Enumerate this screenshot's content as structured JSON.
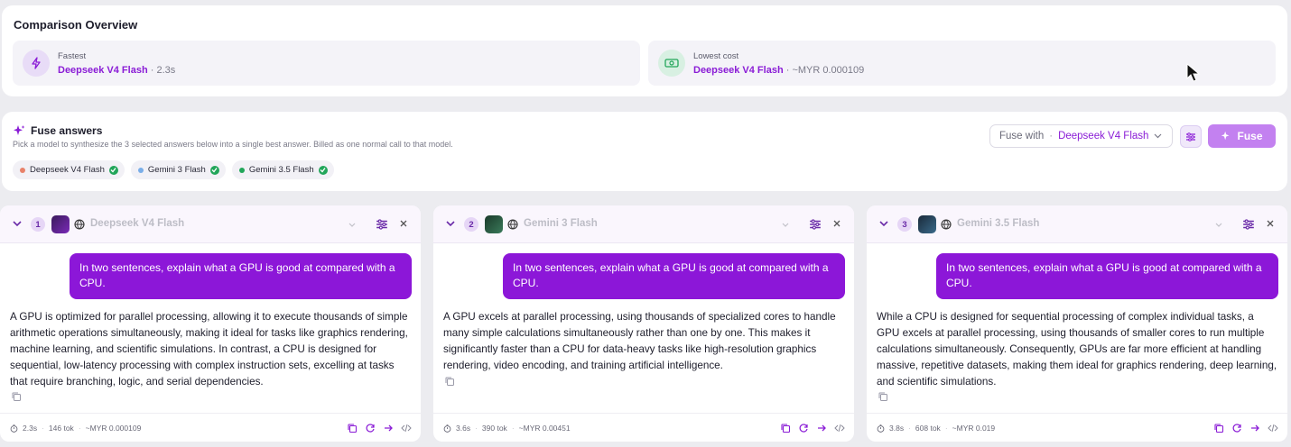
{
  "overview": {
    "title": "Comparison Overview",
    "fastest": {
      "label": "Fastest",
      "model": "Deepseek V4 Flash",
      "extra": " · 2.3s",
      "icon": "lightning-icon"
    },
    "lowest_cost": {
      "label": "Lowest cost",
      "model": "Deepseek V4 Flash",
      "extra": " · ~MYR 0.000109",
      "icon": "cash-icon"
    }
  },
  "fuse": {
    "title": "Fuse answers",
    "description": "Pick a model to synthesize the 3 selected answers below into a single best answer. Billed as one normal call to that model.",
    "chips": [
      {
        "label": "Deepseek V4 Flash",
        "color": "#e8826a"
      },
      {
        "label": "Gemini 3 Flash",
        "color": "#7aaee8"
      },
      {
        "label": "Gemini 3.5 Flash",
        "color": "#22a65a"
      }
    ],
    "fuse_with_label": "Fuse with",
    "fuse_with_value": "Deepseek V4 Flash",
    "button": "Fuse"
  },
  "panels": [
    {
      "index": "1",
      "name": "Deepseek V4 Flash",
      "prompt": "In two sentences, explain what a GPU is good at compared with a CPU.",
      "answer": "A GPU is optimized for parallel processing, allowing it to execute thousands of simple arithmetic operations simultaneously, making it ideal for tasks like graphics rendering, machine learning, and scientific simulations. In contrast, a CPU is designed for sequential, low-latency processing with complex instruction sets, excelling at tasks that require branching, logic, and serial dependencies.",
      "time": "2.3s",
      "tokens": "146 tok",
      "cost": "~MYR 0.000109"
    },
    {
      "index": "2",
      "name": "Gemini 3 Flash",
      "prompt": "In two sentences, explain what a GPU is good at compared with a CPU.",
      "answer": "A GPU excels at parallel processing, using thousands of specialized cores to handle many simple calculations simultaneously rather than one by one. This makes it significantly faster than a CPU for data-heavy tasks like high-resolution graphics rendering, video encoding, and training artificial intelligence.",
      "time": "3.6s",
      "tokens": "390 tok",
      "cost": "~MYR 0.00451"
    },
    {
      "index": "3",
      "name": "Gemini 3.5 Flash",
      "prompt": "In two sentences, explain what a GPU is good at compared with a CPU.",
      "answer": "While a CPU is designed for sequential processing of complex individual tasks, a GPU excels at parallel processing, using thousands of smaller cores to run multiple calculations simultaneously. Consequently, GPUs are far more efficient at handling massive, repetitive datasets, making them ideal for graphics rendering, deep learning, and scientific simulations.",
      "time": "3.8s",
      "tokens": "608 tok",
      "cost": "~MYR 0.019"
    }
  ],
  "colors": {
    "accent": "#8c17d8",
    "fuse_button": "#c381f0",
    "success": "#22a65a"
  }
}
